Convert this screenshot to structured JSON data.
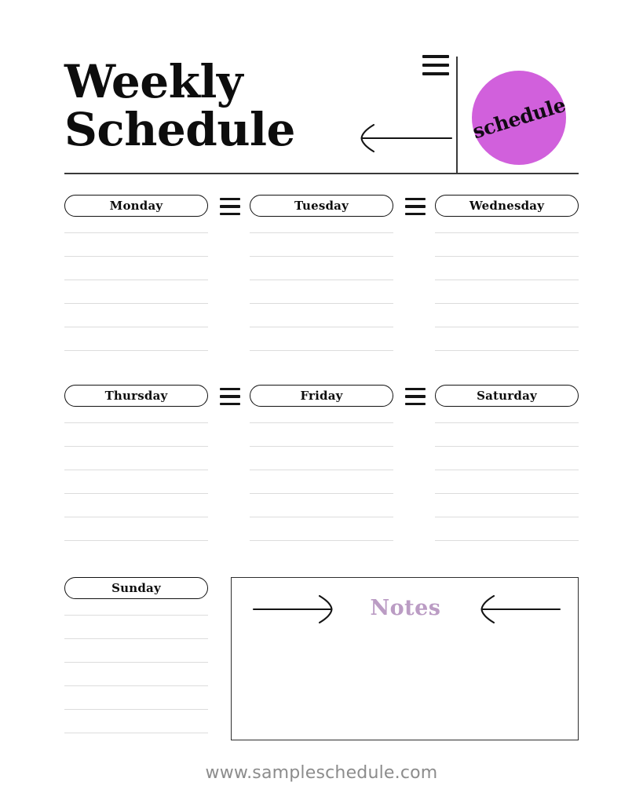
{
  "document": {
    "title_line_1": "Weekly",
    "title_line_2": "Schedule",
    "badge_label": "schedule"
  },
  "colors": {
    "badge_background": "#d160dc",
    "badge_text": "#120a14",
    "notes_title": "#bb9cc4",
    "rule_line": "#dcdcdc",
    "ink": "#0d0d0d",
    "footer_text": "#8c8c8c",
    "page_background": "#ffffff"
  },
  "icons": {
    "header_menu": "hamburger-icon",
    "separator_menu": "hamburger-icon",
    "header_arrow": "arrow-left-icon",
    "notes_arrow_left": "arrow-right-icon",
    "notes_arrow_right": "arrow-left-icon"
  },
  "schedule": {
    "rows": [
      {
        "columns": [
          {
            "day": "Monday",
            "line_count": 6
          },
          {
            "day": "Tuesday",
            "line_count": 6
          },
          {
            "day": "Wednesday",
            "line_count": 6
          }
        ]
      },
      {
        "columns": [
          {
            "day": "Thursday",
            "line_count": 6
          },
          {
            "day": "Friday",
            "line_count": 6
          },
          {
            "day": "Saturday",
            "line_count": 6
          }
        ]
      },
      {
        "columns": [
          {
            "day": "Sunday",
            "line_count": 6
          }
        ]
      }
    ]
  },
  "notes": {
    "title": "Notes",
    "content": ""
  },
  "footer": {
    "url": "www.sampleschedule.com"
  }
}
